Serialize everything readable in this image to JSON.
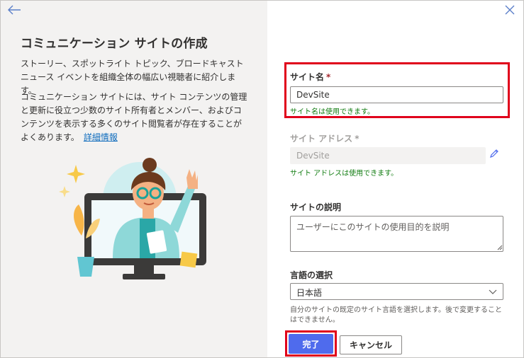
{
  "left": {
    "title": "コミュニケーション サイトの作成",
    "para1": "ストーリー、スポットライト トピック、ブロードキャスト ニュース イベントを組織全体の幅広い視聴者に紹介します。",
    "para2": "コミュニケーション サイトには、サイト コンテンツの管理と更新に役立つ少数のサイト所有者とメンバー、およびコンテンツを表示する多くのサイト閲覧者が存在することがよくあります。",
    "learn_more": "詳細情報"
  },
  "form": {
    "site_name": {
      "label": "サイト名",
      "required_mark": "*",
      "value": "DevSite",
      "status": "サイト名は使用できます。"
    },
    "site_address": {
      "label": "サイト アドレス",
      "required_mark": "*",
      "value": "DevSite",
      "status": "サイト アドレスは使用できます。"
    },
    "description": {
      "label": "サイトの説明",
      "placeholder": "ユーザーにこのサイトの使用目的を説明"
    },
    "language": {
      "label": "言語の選択",
      "selected": "日本語",
      "help": "自分のサイトの既定のサイト言語を選択します。後で変更することはできません。"
    }
  },
  "buttons": {
    "done": "完了",
    "cancel": "キャンセル"
  },
  "colors": {
    "accent": "#4f6bed",
    "success": "#107c10",
    "highlight": "#e0001b",
    "link": "#0f6cbd"
  },
  "icons": {
    "back": "arrow-left-icon",
    "close": "close-icon",
    "edit": "pencil-icon",
    "dropdown": "chevron-down-icon"
  }
}
